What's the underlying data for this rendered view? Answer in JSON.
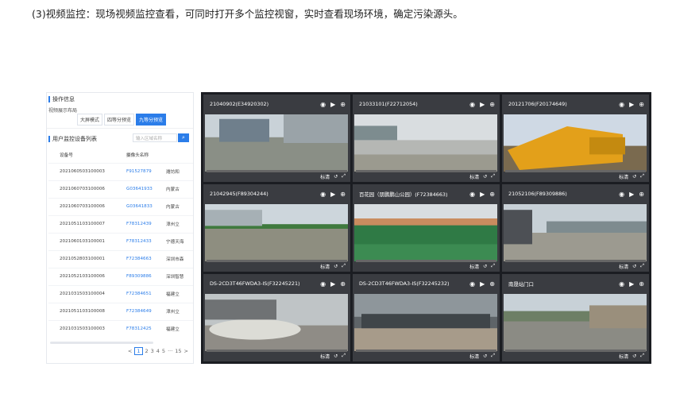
{
  "caption": "(3)视频监控：现场视频监控查看，可同时打开多个监控视窗，实时查看现场环境，确定污染源头。",
  "left_panel": {
    "op_title": "操作信息",
    "layout_label": "视频展示布局",
    "layout_options": [
      "大屏模式",
      "四等分预览",
      "九等分预览"
    ],
    "active_layout": "九等分预览",
    "device_title": "用户监控设备列表",
    "search_placeholder": "输入区域名称",
    "columns": [
      "设备号",
      "摄像头名称"
    ],
    "rows": [
      [
        "2021060503100003",
        "F91527879",
        "潍坊和"
      ],
      [
        "2021060703100006",
        "G03641933",
        "内蒙古"
      ],
      [
        "2021060703100006",
        "G03641833",
        "内蒙古"
      ],
      [
        "2021051103100007",
        "F78312439",
        "漳州立"
      ],
      [
        "2021060103100001",
        "F78312433",
        "宁德天海"
      ],
      [
        "2021052803100001",
        "F72384663",
        "深圳市森"
      ],
      [
        "2021052103100006",
        "F89309886",
        "深圳智慧"
      ],
      [
        "2021031503100004",
        "F72384651",
        "福建立"
      ],
      [
        "2021051103100008",
        "F72384649",
        "漳州立"
      ],
      [
        "2021031503100003",
        "F78312425",
        "福建立"
      ]
    ],
    "pager": [
      "<",
      "1",
      "2",
      "3",
      "4",
      "5",
      "···",
      "15",
      ">"
    ],
    "current_page": "1"
  },
  "cells": [
    {
      "title": "21040902(E34920302)"
    },
    {
      "title": "21033101(F22712054)"
    },
    {
      "title": "20121706(F20174649)"
    },
    {
      "title": "21042945(F89304244)"
    },
    {
      "title": "百花园（朋鹏鹏山公园）(F72384663)"
    },
    {
      "title": "21052106(F89309886)"
    },
    {
      "title": "DS-2CD3T46FWDA3-IS(F32245221)"
    },
    {
      "title": "DS-2CD3T46FWDA3-IS(F32245232)"
    },
    {
      "title": "南晟站门口"
    }
  ],
  "cell_controls": {
    "quality_label": "标清"
  },
  "colors": {
    "accent": "#2b7de9",
    "grid_bg": "#1b1d22",
    "cell_bg": "#3a3c41"
  }
}
